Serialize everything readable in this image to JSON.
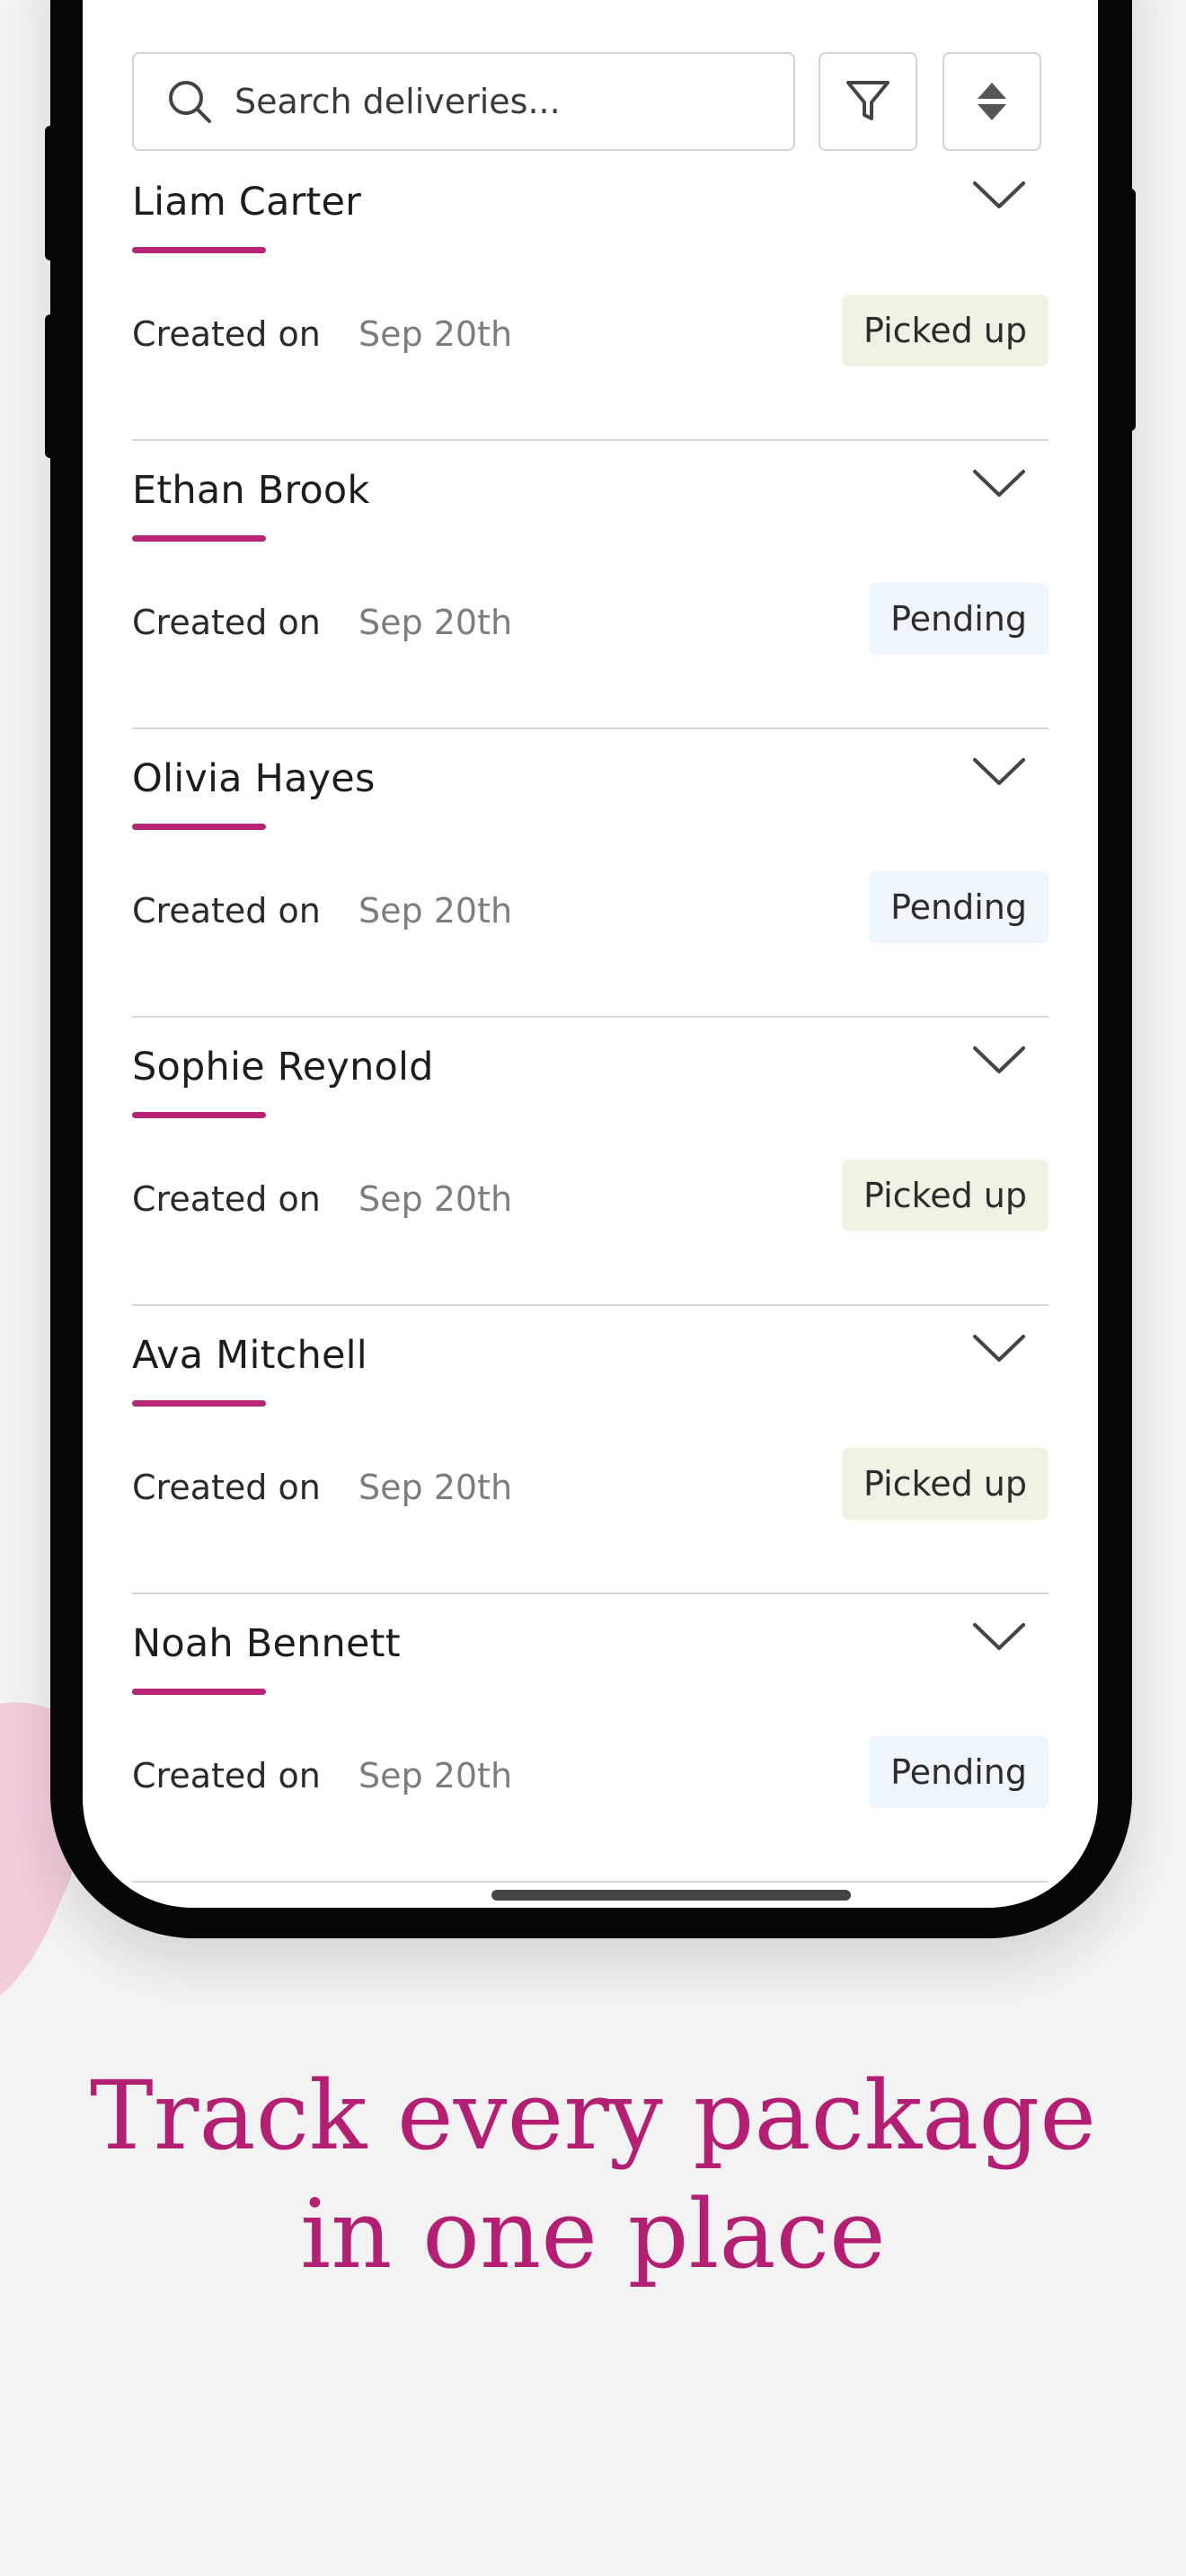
{
  "search": {
    "placeholder": "Search deliveries..."
  },
  "colors": {
    "accent": "#b82476",
    "headline": "#b31f73",
    "picked_up_bg": "#eef3e4",
    "pending_bg": "#eef6fc"
  },
  "deliveries": [
    {
      "name": "Liam Carter",
      "created_label": "Created on",
      "date": "Sep 20th",
      "status": "Picked up"
    },
    {
      "name": "Ethan Brook",
      "created_label": "Created on",
      "date": "Sep 20th",
      "status": "Pending"
    },
    {
      "name": "Olivia Hayes",
      "created_label": "Created on",
      "date": "Sep 20th",
      "status": "Pending"
    },
    {
      "name": "Sophie Reynold",
      "created_label": "Created on",
      "date": "Sep 20th",
      "status": "Picked up"
    },
    {
      "name": "Ava Mitchell",
      "created_label": "Created on",
      "date": "Sep 20th",
      "status": "Picked up"
    },
    {
      "name": "Noah Bennett",
      "created_label": "Created on",
      "date": "Sep 20th",
      "status": "Pending"
    }
  ],
  "headline": {
    "line1": "Track every package",
    "line2": "in one place"
  }
}
